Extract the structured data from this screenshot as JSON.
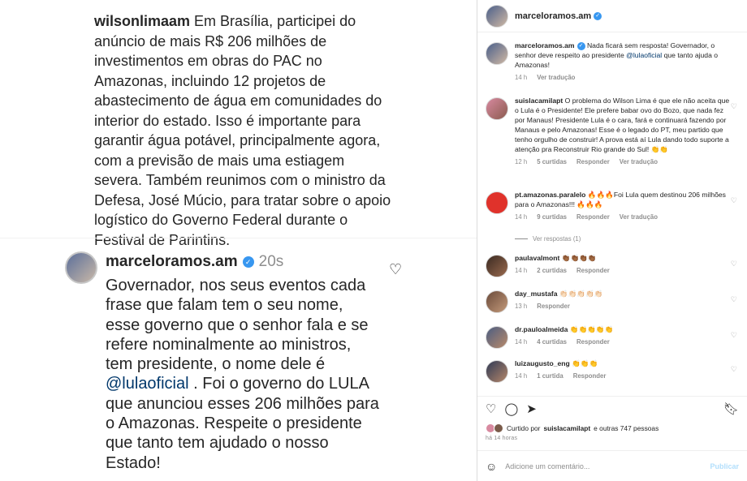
{
  "media": {
    "quote_user": "wilsonlimaam",
    "quote_text": " Em Brasília, participei do anúncio de mais R$ 206 milhões de investimentos em obras do PAC no Amazonas, incluindo 12 projetos de abastecimento de água em comunidades do interior do estado. Isso é  importante para garantir água potável, principalmente agora, com a previsão de mais uma estiagem severa. Também reunimos com o ministro da Defesa, José Múcio, para tratar sobre o apoio logístico do Governo Federal durante o Festival de Parintins.",
    "reply_user": "marceloramos.am",
    "reply_time": "20s",
    "reply_text_1": "Governador, nos seus eventos cada frase que falam tem o seu nome, esse governo que o senhor fala e se refere nominalmente ao ministros, tem presidente, o nome dele é ",
    "reply_mention": "@lulaoficial",
    "reply_text_2": " . Foi o governo do LULA que anunciou esses 206 milhões para o Amazonas. Respeite o presidente que tanto tem ajudado o nosso Estado!"
  },
  "panel": {
    "header_user": "marceloramos.am",
    "caption": {
      "user": "marceloramos.am",
      "text_1": " Nada ficará sem resposta! Governador, o senhor deve respeito ao presidente ",
      "mention": "@lulaoficial",
      "text_2": " que tanto ajuda o Amazonas!",
      "time": "14 h",
      "translate": "Ver tradução"
    },
    "comments": [
      {
        "user": "suislacamilapt",
        "text": " O problema do Wilson Lima é que ele não aceita que o Lula é o Presidente! Ele prefere babar ovo do Bozo, que nada fez por Manaus! Presidente Lula é o cara, fará e continuará fazendo por Manaus e pelo Amazonas! Esse é o legado do PT, meu partido que tenho orgulho de construir! A prova está aí Lula dando todo suporte a atenção pra Reconstruir Rio grande do Sul! 👏👏",
        "time": "12 h",
        "likes": "5 curtidas",
        "reply": "Responder",
        "translate": "Ver tradução"
      },
      {
        "user": "pt.amazonas.paralelo",
        "text": " 🔥🔥🔥Foi Lula quem destinou 206 milhões para o Amazonas!!! 🔥🔥🔥",
        "time": "14 h",
        "likes": "9 curtidas",
        "reply": "Responder",
        "translate": "Ver tradução"
      },
      {
        "user": "paulavalmont",
        "text": " 👏🏾👏🏾👏🏾👏🏾",
        "time": "14 h",
        "likes": "2 curtidas",
        "reply": "Responder",
        "translate": ""
      },
      {
        "user": "day_mustafa",
        "text": " 👏🏻👏🏻👏🏻👏🏻👏🏻",
        "time": "13 h",
        "likes": "",
        "reply": "Responder",
        "translate": ""
      },
      {
        "user": "dr.pauloalmeida",
        "text": " 👏👏👏👏👏",
        "time": "14 h",
        "likes": "4 curtidas",
        "reply": "Responder",
        "translate": ""
      },
      {
        "user": "luizaugusto_eng",
        "text": " 👏👏👏",
        "time": "14 h",
        "likes": "1 curtida",
        "reply": "Responder",
        "translate": ""
      }
    ],
    "view_replies": "Ver respostas (1)",
    "liked_by_prefix": "Curtido por ",
    "liked_by_user": "suislacamilapt",
    "liked_by_suffix": " e outras 747 pessoas",
    "ago": "há 14 horas",
    "add_comment_placeholder": "Adicione um comentário...",
    "publish": "Publicar"
  }
}
